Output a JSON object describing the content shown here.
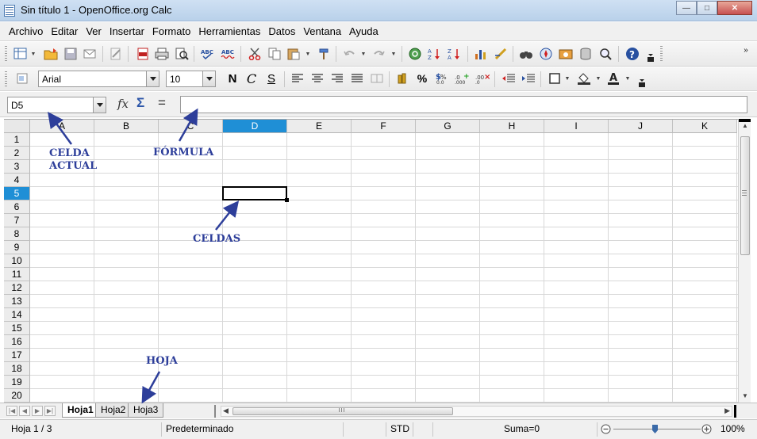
{
  "window": {
    "title": "Sin título 1 - OpenOffice.org Calc"
  },
  "menubar": {
    "items": [
      "Archivo",
      "Editar",
      "Ver",
      "Insertar",
      "Formato",
      "Herramientas",
      "Datos",
      "Ventana",
      "Ayuda"
    ]
  },
  "standard_toolbar": {
    "icons": [
      "new-document-icon",
      "open-folder-icon",
      "save-icon",
      "email-icon",
      "edit-file-icon",
      "export-pdf-icon",
      "print-icon",
      "print-preview-icon",
      "spellcheck-icon",
      "autospellcheck-icon",
      "cut-icon",
      "copy-icon",
      "paste-icon",
      "format-paintbrush-icon",
      "undo-icon",
      "redo-icon",
      "hyperlink-icon",
      "sort-ascending-icon",
      "sort-descending-icon",
      "chart-icon",
      "draw-icon",
      "find-icon",
      "navigator-icon",
      "gallery-icon",
      "data-sources-icon",
      "zoom-icon",
      "help-icon"
    ]
  },
  "formatting_toolbar": {
    "font_name": "Arial",
    "font_size": "10",
    "bold_label": "N",
    "italic_label": "C",
    "underline_label": "S",
    "icons": [
      "styles-icon",
      "align-left-icon",
      "align-center-icon",
      "align-right-icon",
      "justify-icon",
      "merge-cells-icon",
      "currency-icon",
      "percent-icon",
      "standard-format-icon",
      "add-decimal-icon",
      "delete-decimal-icon",
      "decrease-indent-icon",
      "increase-indent-icon",
      "borders-icon",
      "background-color-icon",
      "font-color-icon"
    ]
  },
  "formula_bar": {
    "name_box": "D5",
    "fx_label": "fx",
    "sum_label": "Σ",
    "equals_label": "=",
    "formula_value": ""
  },
  "grid": {
    "columns": [
      "A",
      "B",
      "C",
      "D",
      "E",
      "F",
      "G",
      "H",
      "I",
      "J",
      "K"
    ],
    "rows": [
      "1",
      "2",
      "3",
      "4",
      "5",
      "6",
      "7",
      "8",
      "9",
      "10",
      "11",
      "12",
      "13",
      "14",
      "15",
      "16",
      "17",
      "18",
      "19",
      "20"
    ],
    "selected_column": "D",
    "selected_row": "5"
  },
  "sheet_tabs": {
    "tabs": [
      "Hoja1",
      "Hoja2",
      "Hoja3"
    ],
    "active": "Hoja1"
  },
  "statusbar": {
    "sheet_info": "Hoja 1 / 3",
    "page_style": "Predeterminado",
    "selection_mode": "STD",
    "sum": "Suma=0",
    "zoom": "100%",
    "zoom_level": 100
  },
  "annotations": {
    "celda_actual": [
      "CELDA",
      "ACTUAL"
    ],
    "formula": "FÓRMULA",
    "celdas": "CELDAS",
    "hoja": "HOJA"
  },
  "colors": {
    "selection_header": "#1f8fd6",
    "annotation": "#2d3e9a"
  }
}
